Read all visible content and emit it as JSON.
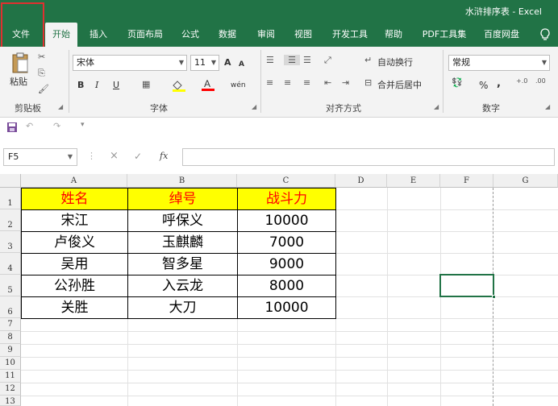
{
  "window": {
    "title": "水浒排序表  -  Excel"
  },
  "tabs": [
    "文件",
    "开始",
    "插入",
    "页面布局",
    "公式",
    "数据",
    "审阅",
    "视图",
    "开发工具",
    "帮助",
    "PDF工具集",
    "百度网盘"
  ],
  "tell_me_icon": "lightbulb-icon",
  "ribbon": {
    "clipboard": {
      "paste": "粘贴",
      "label": "剪贴板"
    },
    "font": {
      "name": "宋体",
      "size": "11",
      "bold": "B",
      "italic": "I",
      "underline": "U",
      "grow": "A",
      "shrink": "A",
      "phonetic": "wén",
      "label": "字体"
    },
    "alignment": {
      "wrap": "自动换行",
      "merge": "合并后居中",
      "label": "对齐方式"
    },
    "number": {
      "format": "常规",
      "percent": "%",
      "comma": ",",
      "label": "数字"
    }
  },
  "formula_bar": {
    "name_box": "F5",
    "cancel": "×",
    "enter": "✓",
    "fx": "fx",
    "value": ""
  },
  "columns": [
    "A",
    "B",
    "C",
    "D",
    "E",
    "F",
    "G"
  ],
  "rows": [
    "1",
    "2",
    "3",
    "4",
    "5",
    "6",
    "7",
    "8",
    "9",
    "10",
    "11",
    "12",
    "13"
  ],
  "table": {
    "headers": [
      "姓名",
      "绰号",
      "战斗力"
    ],
    "rows": [
      [
        "宋江",
        "呼保义",
        "10000"
      ],
      [
        "卢俊义",
        "玉麒麟",
        "7000"
      ],
      [
        "吴用",
        "智多星",
        "9000"
      ],
      [
        "公孙胜",
        "入云龙",
        "8000"
      ],
      [
        "关胜",
        "大刀",
        "10000"
      ]
    ]
  },
  "selected_cell": "F5",
  "colors": {
    "accent": "#217346",
    "header_fill": "#ffff00",
    "header_text": "#ff0000",
    "annotation": "#e03030"
  }
}
